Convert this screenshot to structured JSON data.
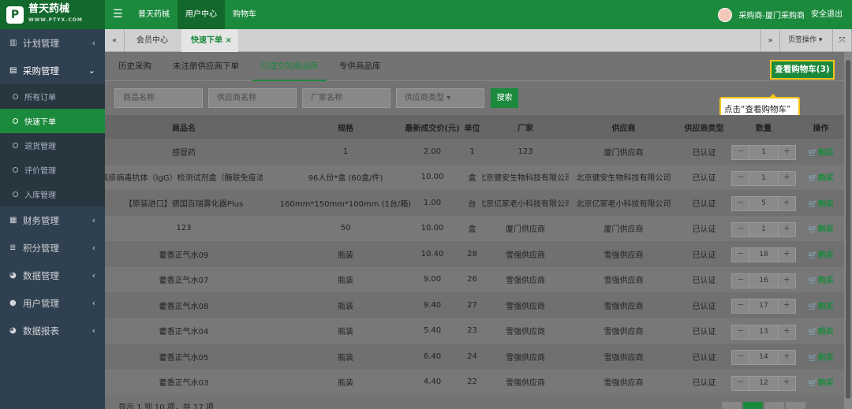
{
  "brand": {
    "name": "普天药械",
    "tagline": "WWW.PTYX.COM",
    "mark": "P"
  },
  "topnav": {
    "menu_icon": "menu-icon",
    "items": [
      "普天药械",
      "用户中心",
      "购物车"
    ],
    "user": "采购商-厦门采购商",
    "logout": "安全退出"
  },
  "sidebar": {
    "items": [
      {
        "icon": "chart-icon",
        "label": "计划管理",
        "arrow": "‹"
      },
      {
        "icon": "cart-icon",
        "label": "采购管理",
        "arrow": "⌄"
      }
    ],
    "subitems": [
      "所有订单",
      "快速下单",
      "退货管理",
      "评价管理",
      "入库管理"
    ],
    "items2": [
      {
        "icon": "calculator-icon",
        "label": "财务管理",
        "arrow": "‹"
      },
      {
        "icon": "database-icon",
        "label": "积分管理",
        "arrow": "‹"
      },
      {
        "icon": "pie-chart-icon",
        "label": "数据管理",
        "arrow": "‹"
      },
      {
        "icon": "user-icon",
        "label": "用户管理",
        "arrow": "‹"
      },
      {
        "icon": "pie-chart-icon",
        "label": "数据报表",
        "arrow": "‹"
      }
    ]
  },
  "tabbar": {
    "prev": "«",
    "tabs": [
      "会员中心",
      "快速下单"
    ],
    "close": "×",
    "next": "»",
    "page_ops": "页签操作 ▾",
    "fullscreen": "⤧"
  },
  "subtabs": [
    "历史采购",
    "未注册供应商下单",
    "已成交的商品库",
    "专供商品库"
  ],
  "cart_button": "查看购物车(3)",
  "tooltip": "点击“查看购物车”",
  "filters": {
    "name_placeholder": "商品名称",
    "supplier_placeholder": "供应商名称",
    "maker_placeholder": "厂家名称",
    "supplier_type": "供应商类型 ▾",
    "search": "搜索"
  },
  "table": {
    "headers": [
      "商品名",
      "规格",
      "最新成交价(元)",
      "单位",
      "厂家",
      "供应商",
      "供应商类型",
      "数量",
      "操作"
    ],
    "rows": [
      [
        "感冒药",
        "1",
        "2.00",
        "1",
        "123",
        "厦门供应商",
        "已认证",
        "1"
      ],
      [
        "风疹病毒抗体（IgG）检测试剂盒（酶联免疫法)",
        "96人份*盒 (60盒/件)",
        "10.00",
        "盒",
        "北京健安生物科技有限公司",
        "北京健安生物科技有限公司",
        "已认证",
        "1"
      ],
      [
        "【原装进口】德国百瑞雾化器Plus",
        "160mm*150mm*100mm (1台/箱)",
        "1.00",
        "台",
        "北京亿家老小科技有限公司",
        "北京亿家老小科技有限公司",
        "已认证",
        "5"
      ],
      [
        "123",
        "50",
        "10.00",
        "盒",
        "厦门供应商",
        "厦门供应商",
        "已认证",
        "1"
      ],
      [
        "藿香正气水09",
        "瓶装",
        "10.40",
        "28",
        "雪强供应商",
        "雪强供应商",
        "已认证",
        "18"
      ],
      [
        "藿香正气水07",
        "瓶装",
        "9.00",
        "26",
        "雪强供应商",
        "雪强供应商",
        "已认证",
        "16"
      ],
      [
        "藿香正气水08",
        "瓶装",
        "9.40",
        "27",
        "雪强供应商",
        "雪强供应商",
        "已认证",
        "17"
      ],
      [
        "藿香正气水04",
        "瓶装",
        "5.40",
        "23",
        "雪强供应商",
        "雪强供应商",
        "已认证",
        "13"
      ],
      [
        "藿香正气水05",
        "瓶装",
        "6.40",
        "24",
        "雪强供应商",
        "雪强供应商",
        "已认证",
        "14"
      ],
      [
        "藿香正气水03",
        "瓶装",
        "4.40",
        "22",
        "雪强供应商",
        "雪强供应商",
        "已认证",
        "12"
      ]
    ],
    "minus": "－",
    "plus": "＋",
    "buy": "🛒购买"
  },
  "footer": "显示 1 到 10 项，共 17 项"
}
